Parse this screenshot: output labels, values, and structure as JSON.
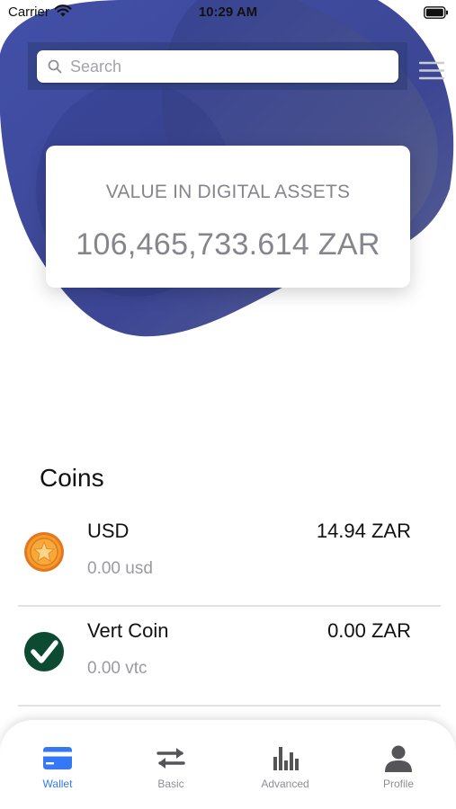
{
  "status_bar": {
    "carrier": "Carrier",
    "time": "10:29 AM"
  },
  "search": {
    "placeholder": "Search"
  },
  "portfolio": {
    "label": "VALUE IN DIGITAL ASSETS",
    "amount": "106,465,733.614 ZAR"
  },
  "coins": {
    "title": "Coins",
    "items": [
      {
        "name": "USD",
        "value": "14.94 ZAR",
        "balance": "0.00 usd",
        "icon": "star-coin-icon"
      },
      {
        "name": "Vert Coin",
        "value": "0.00 ZAR",
        "balance": "0.00 vtc",
        "icon": "vertcoin-icon"
      }
    ]
  },
  "tab_bar": {
    "active": "Wallet",
    "items": [
      {
        "label": "Wallet",
        "icon": "wallet-icon"
      },
      {
        "label": "Basic",
        "icon": "transfer-arrows-icon"
      },
      {
        "label": "Advanced",
        "icon": "bar-chart-icon"
      },
      {
        "label": "Profile",
        "icon": "person-icon"
      }
    ]
  },
  "colors": {
    "accent": "#3478f6",
    "header_blob": "#3b4897",
    "tab_inactive": "#8e8e93"
  }
}
